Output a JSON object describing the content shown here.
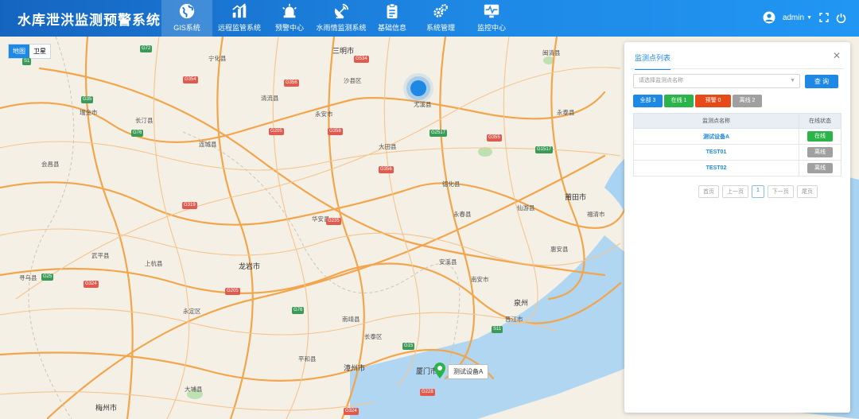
{
  "app": {
    "title": "水库泄洪监测预警系统"
  },
  "nav": [
    {
      "label": "GIS系统",
      "icon": "globe-icon",
      "active": true
    },
    {
      "label": "远程监管系统",
      "icon": "bar-chart-icon",
      "active": false
    },
    {
      "label": "预警中心",
      "icon": "alarm-light-icon",
      "active": false
    },
    {
      "label": "水雨情监测系统",
      "icon": "satellite-dish-icon",
      "active": false
    },
    {
      "label": "基础信息",
      "icon": "clipboard-icon",
      "active": false
    },
    {
      "label": "系统管理",
      "icon": "gears-icon",
      "active": false
    },
    {
      "label": "监控中心",
      "icon": "monitor-pulse-icon",
      "active": false
    }
  ],
  "user": {
    "name": "admin"
  },
  "map": {
    "toggle": [
      "地图",
      "卫星"
    ],
    "active_toggle": "地图",
    "places": [
      {
        "t": "三明市",
        "city": true
      },
      {
        "t": "长汀县"
      },
      {
        "t": "连城县"
      },
      {
        "t": "上杭县"
      },
      {
        "t": "龙岩市",
        "city": true
      },
      {
        "t": "永定区"
      },
      {
        "t": "平和县"
      },
      {
        "t": "南靖县"
      },
      {
        "t": "漳州市",
        "city": true
      },
      {
        "t": "厦门市",
        "city": true
      },
      {
        "t": "泉州",
        "city": true
      },
      {
        "t": "莆田市",
        "city": true
      },
      {
        "t": "福清市"
      },
      {
        "t": "永春县"
      },
      {
        "t": "仙游县"
      },
      {
        "t": "大田县"
      },
      {
        "t": "德化县"
      },
      {
        "t": "安溪县"
      },
      {
        "t": "南安市"
      },
      {
        "t": "惠安县"
      },
      {
        "t": "晋江市"
      },
      {
        "t": "长泰区"
      },
      {
        "t": "华安县"
      },
      {
        "t": "梅州市",
        "city": true
      },
      {
        "t": "大埔县"
      },
      {
        "t": "武平县"
      },
      {
        "t": "寻乌县"
      },
      {
        "t": "会昌县"
      },
      {
        "t": "瑞金市"
      },
      {
        "t": "宁化县"
      },
      {
        "t": "清流县"
      },
      {
        "t": "永安市"
      },
      {
        "t": "尤溪县"
      },
      {
        "t": "闽清县"
      },
      {
        "t": "永泰县"
      },
      {
        "t": "沙县区"
      }
    ],
    "shields": [
      {
        "t": "G72",
        "c": "g"
      },
      {
        "t": "G534",
        "c": "r"
      },
      {
        "t": "G354",
        "c": "r"
      },
      {
        "t": "G356",
        "c": "r"
      },
      {
        "t": "G35",
        "c": "g"
      },
      {
        "t": "G76",
        "c": "g"
      },
      {
        "t": "G205",
        "c": "r"
      },
      {
        "t": "G358",
        "c": "r"
      },
      {
        "t": "G2517",
        "c": "g"
      },
      {
        "t": "G355",
        "c": "r"
      },
      {
        "t": "G1517",
        "c": "g"
      },
      {
        "t": "G356",
        "c": "r"
      },
      {
        "t": "G319",
        "c": "r"
      },
      {
        "t": "G235",
        "c": "r"
      },
      {
        "t": "G15",
        "c": "g"
      },
      {
        "t": "G324",
        "c": "r"
      },
      {
        "t": "G25",
        "c": "g"
      },
      {
        "t": "G228",
        "c": "r"
      },
      {
        "t": "G324",
        "c": "r"
      },
      {
        "t": "G76",
        "c": "g"
      },
      {
        "t": "S1",
        "c": "g"
      },
      {
        "t": "S11",
        "c": "g"
      },
      {
        "t": "G205",
        "c": "r"
      }
    ],
    "marker_label": "测试设备A"
  },
  "panel": {
    "tab": "监测点列表",
    "select_placeholder": "请选择监测点名称",
    "query_label": "查 询",
    "filters": [
      "全部 3",
      "在线 1",
      "预警 0",
      "离线 2"
    ],
    "columns": [
      "监测点名称",
      "在线状态"
    ],
    "rows": [
      {
        "name": "测试设备A",
        "status": "在线",
        "state": "on"
      },
      {
        "name": "TEST01",
        "status": "离线",
        "state": "off"
      },
      {
        "name": "TEST02",
        "status": "离线",
        "state": "off"
      }
    ],
    "pager": [
      "首页",
      "上一页",
      "1",
      "下一页",
      "尾页"
    ]
  },
  "colors": {
    "header_start": "#1565c0",
    "accent": "#1e88e5",
    "online": "#2bb44a",
    "warning": "#e64a19",
    "offline": "#a0a0a0"
  }
}
